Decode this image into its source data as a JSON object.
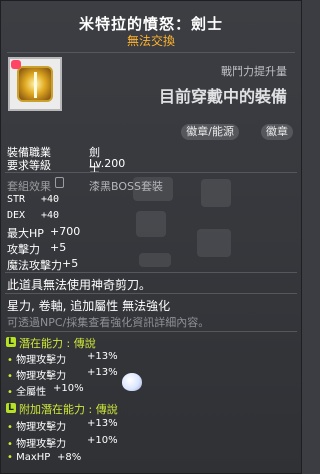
{
  "header": {
    "title": "米特拉的憤怒：劍士",
    "untradable": "無法交換"
  },
  "icon": {
    "name": "mitra-emblem-icon"
  },
  "side": {
    "power_caption": "戰鬥力提升量",
    "wearing_title": "目前穿戴中的裝備"
  },
  "badges": [
    "徽章/能源",
    "徽章"
  ],
  "info": {
    "job_label": "裝備職業",
    "job_value": "劍士",
    "level_label": "要求等級",
    "level_value": "Lv.200"
  },
  "set": {
    "label": "套組效果",
    "name": "漆黑BOSS套裝"
  },
  "stats": [
    {
      "name": "STR",
      "value": "+40"
    },
    {
      "name": "DEX",
      "value": "+40"
    },
    {
      "name": "最大HP",
      "value": "+700"
    },
    {
      "name": "攻擊力",
      "value": "+5"
    },
    {
      "name": "魔法攻擊力",
      "value": "+5"
    }
  ],
  "notes": {
    "no_scissors": "此道具無法使用神奇剪刀。",
    "enhance": "星力, 卷軸, 追加屬性 無法強化",
    "npc_hint": "可透過NPC/採集查看強化資訊詳細內容。"
  },
  "potential": {
    "tier_mark": "L",
    "title": "潛在能力 : 傳說",
    "lines": [
      {
        "bullet": "•",
        "name": "物理攻擊力",
        "value": "+13%"
      },
      {
        "bullet": "•",
        "name": "物理攻擊力",
        "value": "+13%"
      },
      {
        "bullet": "•",
        "name": "全屬性",
        "value": "+10%"
      }
    ]
  },
  "additional": {
    "tier_mark": "L",
    "title": "附加潛在能力 : 傳說",
    "lines": [
      {
        "bullet": "•",
        "name": "物理攻擊力",
        "value": "+13%"
      },
      {
        "bullet": "•",
        "name": "物理攻擊力",
        "value": "+10%"
      },
      {
        "bullet": "•",
        "name": "MaxHP",
        "value": "+8%"
      }
    ]
  },
  "colors": {
    "title": "#ffffff",
    "untradable": "#ffb32d",
    "legendary": "#b6df2a",
    "hint": "#8f9196"
  }
}
